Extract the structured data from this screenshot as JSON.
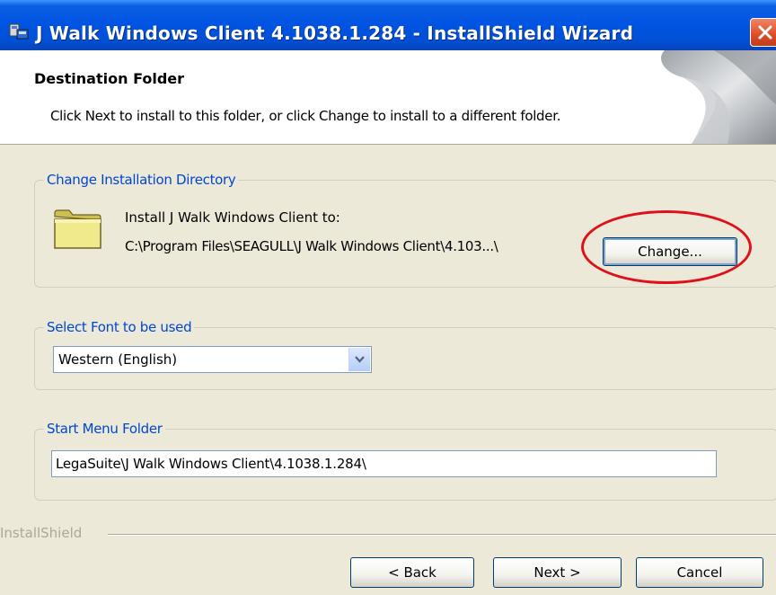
{
  "window": {
    "title": "J Walk Windows Client 4.1038.1.284 - InstallShield Wizard"
  },
  "header": {
    "title": "Destination Folder",
    "description": "Click Next to install to this folder, or click Change to install to a different folder."
  },
  "install_dir": {
    "legend": "Change Installation Directory",
    "label": "Install J Walk Windows Client to:",
    "path": "C:\\Program Files\\SEAGULL\\J Walk Windows Client\\4.103...\\",
    "change_label": "Change..."
  },
  "font": {
    "legend": "Select Font to be used",
    "selected": "Western (English)"
  },
  "start_menu": {
    "legend": "Start Menu Folder",
    "value": "LegaSuite\\J Walk Windows Client\\4.1038.1.284\\"
  },
  "footer": {
    "brand": "InstallShield",
    "back_label": "< Back",
    "next_label": "Next >",
    "cancel_label": "Cancel"
  },
  "icons": {
    "title": "installer-icon",
    "close": "close-icon",
    "folder": "folder-icon",
    "dropdown": "chevron-down-icon"
  },
  "colors": {
    "accent_blue": "#0046d5",
    "highlight_red": "#e0101a"
  }
}
